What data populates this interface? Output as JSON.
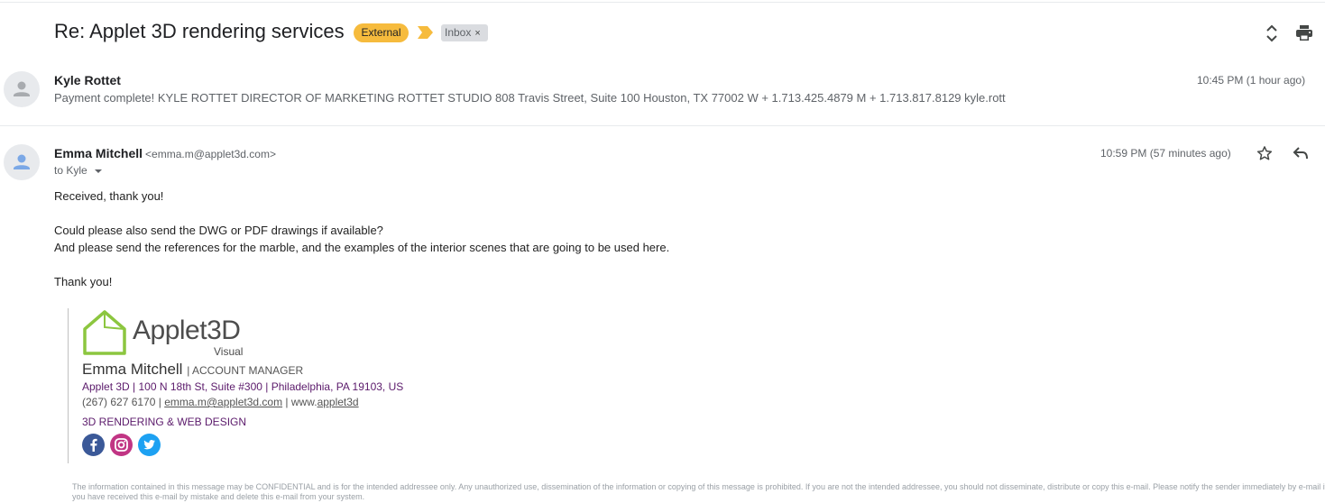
{
  "thread": {
    "subject": "Re: Applet 3D rendering services",
    "external_label": "External",
    "inbox_label": "Inbox",
    "inbox_remove": "×"
  },
  "icons": {
    "expand": "unfold-icon",
    "print": "print-icon",
    "star": "star-icon",
    "reply": "reply-icon",
    "importance": "importance-marker-icon"
  },
  "messages": [
    {
      "sender": "Kyle Rottet",
      "time": "10:45 PM (1 hour ago)",
      "snippet": "Payment complete! KYLE ROTTET DIRECTOR OF MARKETING ROTTET STUDIO 808 Travis Street, Suite 100 Houston, TX 77002 W + 1.713.425.4879 M + 1.713.817.8129 kyle.rott"
    },
    {
      "sender": "Emma Mitchell",
      "email": "<emma.m@applet3d.com>",
      "time": "10:59 PM (57 minutes ago)",
      "to": "to Kyle",
      "body": [
        "Received, thank you!",
        "Could please also send the DWG or PDF drawings if available?",
        "And please send the references for the marble, and the examples of the interior scenes that are going to be used here.",
        "Thank you!"
      ]
    }
  ],
  "signature": {
    "brand": "Applet3D",
    "brand_sub": "Visual",
    "name": "Emma Mitchell",
    "role": "| ACCOUNT MANAGER",
    "address": "Applet 3D | 100 N 18th St, Suite #300 | Philadelphia, PA 19103, US",
    "phone": "(267) 627 6170 | ",
    "email_link": "emma.m@applet3d.com",
    "web_prefix": " | www.",
    "web_link": "applet3d",
    "tagline": "3D RENDERING & WEB DESIGN",
    "social": [
      "facebook-icon",
      "instagram-icon",
      "twitter-icon"
    ]
  },
  "disclaimer": "The information contained in this message may be CONFIDENTIAL and is for the intended addressee only. Any unauthorized use, dissemination of the information or copying of this message is prohibited. If you are not the intended addressee, you should not disseminate, distribute or copy this e-mail. Please notify the sender immediately by e-mail if you have received this e-mail by mistake and delete this e-mail from your system.",
  "colors": {
    "external_badge": "#f6bb3d",
    "importance_marker": "#f6bb3d",
    "brand_green": "#8cc63f",
    "signature_purple": "#5b1a6b"
  }
}
